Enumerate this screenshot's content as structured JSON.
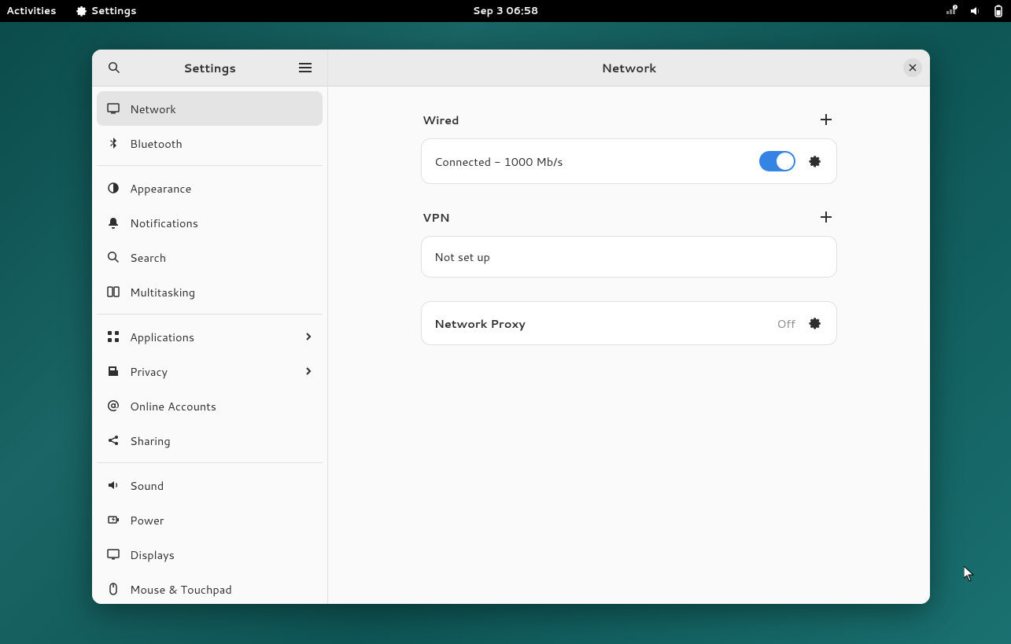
{
  "topbar": {
    "activities": "Activities",
    "app_name": "Settings",
    "datetime": "Sep 3  06:58"
  },
  "sidebar": {
    "title": "Settings",
    "groups": [
      [
        {
          "icon": "monitor",
          "label": "Network",
          "active": true
        },
        {
          "icon": "bluetooth",
          "label": "Bluetooth"
        }
      ],
      [
        {
          "icon": "appearance",
          "label": "Appearance"
        },
        {
          "icon": "bell",
          "label": "Notifications"
        },
        {
          "icon": "search",
          "label": "Search"
        },
        {
          "icon": "multitask",
          "label": "Multitasking"
        }
      ],
      [
        {
          "icon": "apps",
          "label": "Applications",
          "chevron": true
        },
        {
          "icon": "privacy",
          "label": "Privacy",
          "chevron": true
        },
        {
          "icon": "at",
          "label": "Online Accounts"
        },
        {
          "icon": "share",
          "label": "Sharing"
        }
      ],
      [
        {
          "icon": "sound",
          "label": "Sound"
        },
        {
          "icon": "power",
          "label": "Power"
        },
        {
          "icon": "displays",
          "label": "Displays"
        },
        {
          "icon": "mouse",
          "label": "Mouse & Touchpad"
        }
      ]
    ]
  },
  "main": {
    "title": "Network",
    "wired": {
      "heading": "Wired",
      "status": "Connected - 1000 Mb/s",
      "enabled": true
    },
    "vpn": {
      "heading": "VPN",
      "status": "Not set up"
    },
    "proxy": {
      "heading": "Network Proxy",
      "status": "Off"
    }
  }
}
